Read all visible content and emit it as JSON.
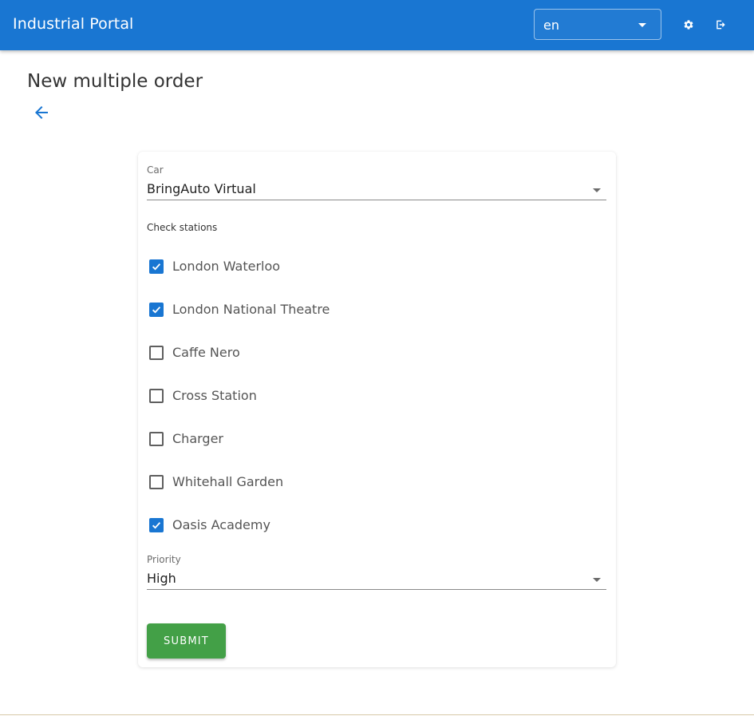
{
  "app": {
    "title": "Industrial Portal"
  },
  "header": {
    "language": {
      "value": "en"
    },
    "icons": {
      "settings": "gear-icon",
      "logout": "logout-icon"
    }
  },
  "page": {
    "title": "New multiple order",
    "back_icon": "arrow-left-icon"
  },
  "form": {
    "car": {
      "label": "Car",
      "value": "BringAuto Virtual"
    },
    "stations_label": "Check stations",
    "stations": [
      {
        "label": "London Waterloo",
        "checked": true
      },
      {
        "label": "London National Theatre",
        "checked": true
      },
      {
        "label": "Caffe Nero",
        "checked": false
      },
      {
        "label": "Cross Station",
        "checked": false
      },
      {
        "label": "Charger",
        "checked": false
      },
      {
        "label": "Whitehall Garden",
        "checked": false
      },
      {
        "label": "Oasis Academy",
        "checked": true
      }
    ],
    "priority": {
      "label": "Priority",
      "value": "High"
    },
    "submit_label": "SUBMIT"
  },
  "colors": {
    "appbar": "#1976d2",
    "checkbox_checked": "#1976d2",
    "submit": "#43a047"
  }
}
